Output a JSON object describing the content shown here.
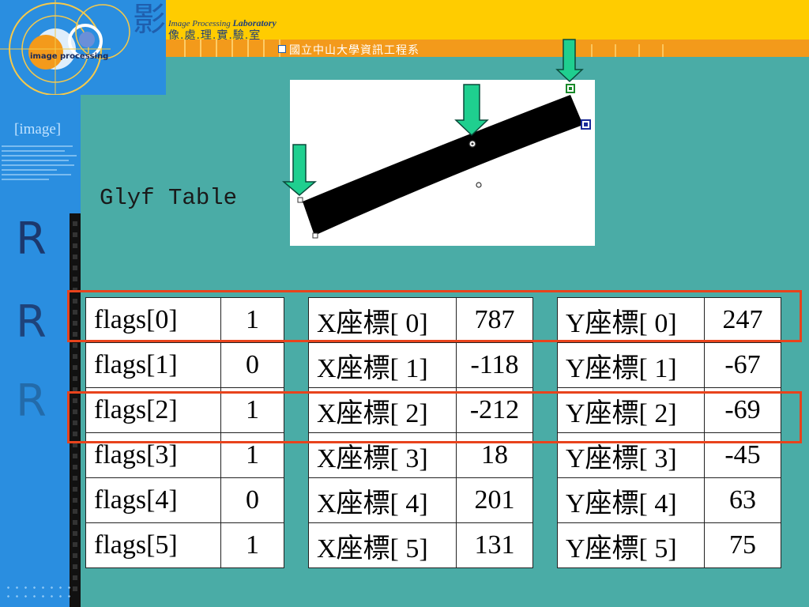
{
  "header": {
    "logo_word": "image processing",
    "calligraphy": "影",
    "lab_en_prefix": "Image Processing",
    "lab_en_main": "Laboratory",
    "lab_zh": "像.處.理.實.驗.室",
    "department": "國立中山大學資訊工程系"
  },
  "sidebar": {
    "image_word": "[image]",
    "letters": [
      "R",
      "R",
      "R"
    ]
  },
  "slide": {
    "label": "Glyf Table"
  },
  "tables": {
    "flags": [
      {
        "label": "flags[0]",
        "value": "1"
      },
      {
        "label": "flags[1]",
        "value": "0"
      },
      {
        "label": "flags[2]",
        "value": "1"
      },
      {
        "label": "flags[3]",
        "value": "1"
      },
      {
        "label": "flags[4]",
        "value": "0"
      },
      {
        "label": "flags[5]",
        "value": "1"
      }
    ],
    "x": [
      {
        "label": "X座標[ 0]",
        "value": "787"
      },
      {
        "label": "X座標[ 1]",
        "value": "-118"
      },
      {
        "label": "X座標[ 2]",
        "value": "-212"
      },
      {
        "label": "X座標[ 3]",
        "value": "18"
      },
      {
        "label": "X座標[ 4]",
        "value": "201"
      },
      {
        "label": "X座標[ 5]",
        "value": "131"
      }
    ],
    "y": [
      {
        "label": "Y座標[ 0]",
        "value": "247"
      },
      {
        "label": "Y座標[ 1]",
        "value": "-67"
      },
      {
        "label": "Y座標[ 2]",
        "value": "-69"
      },
      {
        "label": "Y座標[ 3]",
        "value": "-45"
      },
      {
        "label": "Y座標[ 4]",
        "value": "63"
      },
      {
        "label": "Y座標[ 5]",
        "value": "75"
      }
    ]
  },
  "colors": {
    "background": "#4aaca6",
    "sidebar": "#2a8ee0",
    "header_yellow": "#ffcc00",
    "header_orange": "#f39a1b",
    "highlight": "#e8431c",
    "arrow": "#1fcf8f"
  }
}
